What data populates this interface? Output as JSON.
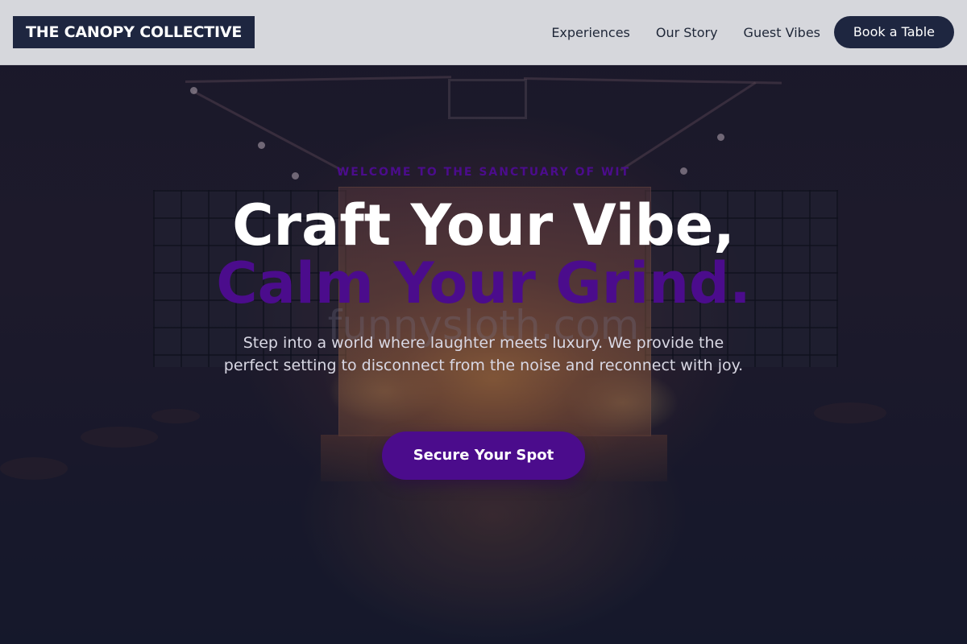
{
  "brand": {
    "logo_text": "THE CANOPY COLLECTIVE"
  },
  "nav": {
    "links": [
      "Experiences",
      "Our Story",
      "Guest Vibes"
    ],
    "cta_label": "Book a Table"
  },
  "hero": {
    "eyebrow": "WELCOME TO THE SANCTUARY OF WIT",
    "headline_line1": "Craft Your Vibe,",
    "headline_line2": "Calm Your Grind.",
    "watermark": "funnysloth.com",
    "subtext": "Step into a world where laughter meets luxury. We provide the perfect setting to disconnect from the noise and reconnect with joy.",
    "cta_label": "Secure Your Spot",
    "background_image": "dimly lit comedy club stage"
  },
  "colors": {
    "brand_navy": "#1e2640",
    "accent_purple": "#4b0c8c",
    "nav_background": "#dddee2",
    "headline_white": "#ffffff"
  }
}
